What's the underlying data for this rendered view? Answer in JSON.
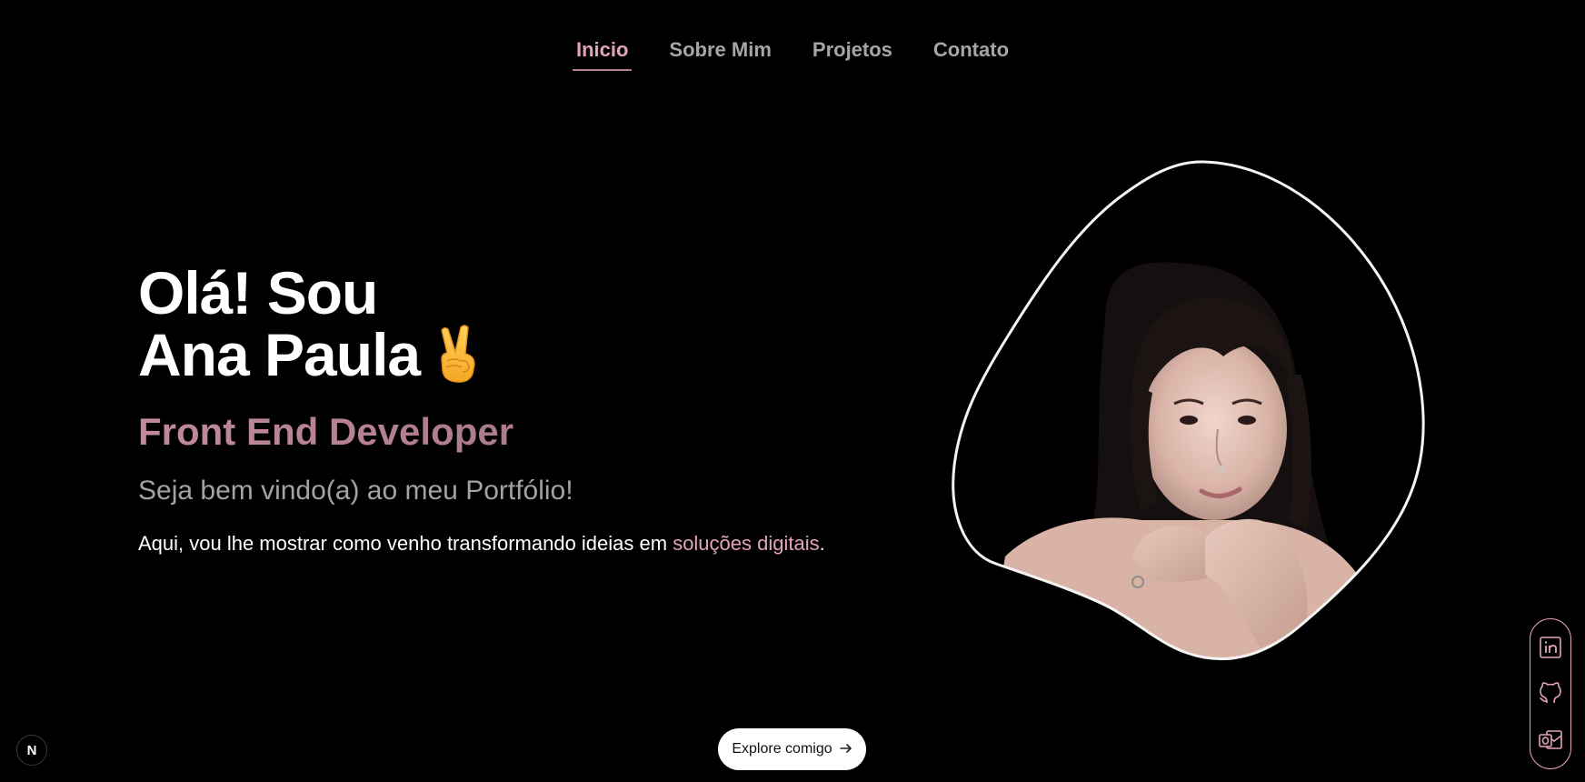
{
  "nav": {
    "items": [
      {
        "label": "Inicio",
        "active": true
      },
      {
        "label": "Sobre Mim",
        "active": false
      },
      {
        "label": "Projetos",
        "active": false
      },
      {
        "label": "Contato",
        "active": false
      }
    ]
  },
  "hero": {
    "title_line1": "Olá! Sou",
    "title_line2": "Ana Paula",
    "title_emoji": "✌",
    "role": "Front End Developer",
    "welcome": "Seja bem vindo(a) ao meu Portfólio!",
    "description_prefix": "Aqui, vou lhe mostrar como venho transformando ideias em ",
    "description_highlight": "soluções digitais",
    "description_suffix": "."
  },
  "cta": {
    "label": "Explore comigo",
    "icon": "arrow-right-icon"
  },
  "badge": {
    "label": "N"
  },
  "social": {
    "items": [
      {
        "icon": "linkedin-icon"
      },
      {
        "icon": "github-icon"
      },
      {
        "icon": "outlook-icon"
      }
    ]
  },
  "colors": {
    "background": "#000000",
    "accent": "#e3a4b6",
    "nav_inactive": "#a6a6a6",
    "role_gradient_start": "#c28a9b",
    "role_gradient_end": "#8d6975"
  }
}
